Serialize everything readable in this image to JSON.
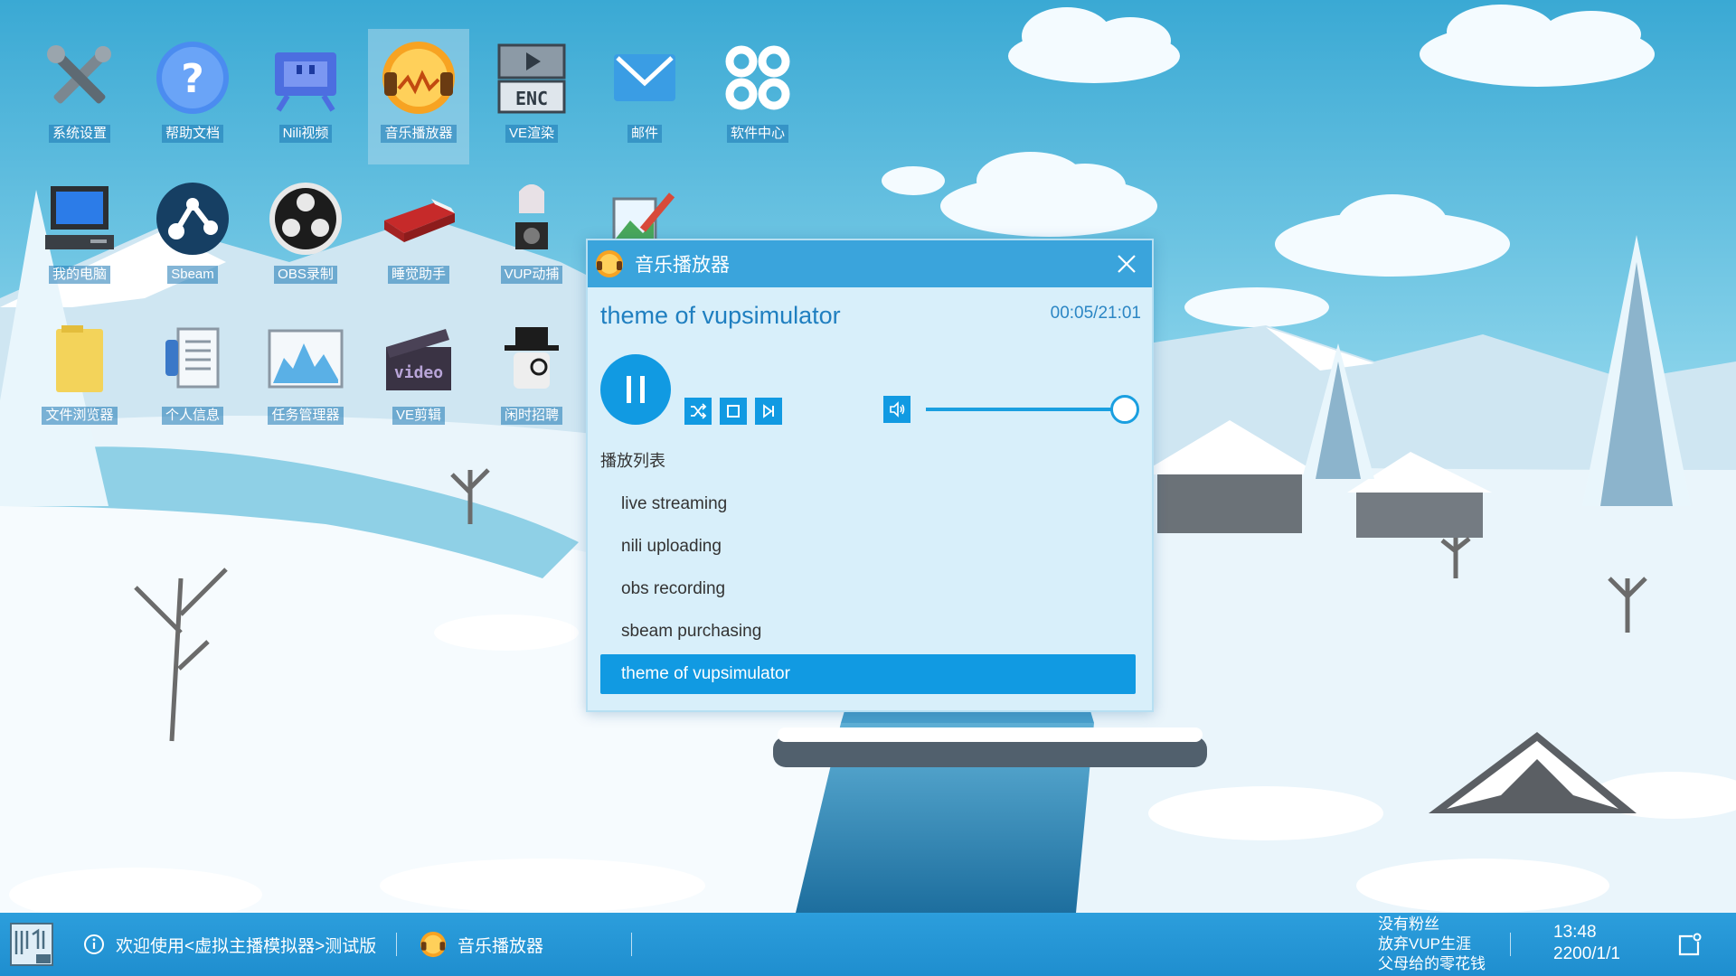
{
  "desktop": {
    "icons": [
      {
        "label": "系统设置",
        "icon": "tools-icon"
      },
      {
        "label": "帮助文档",
        "icon": "help-icon"
      },
      {
        "label": "Nili视频",
        "icon": "tv-icon"
      },
      {
        "label": "音乐播放器",
        "icon": "music-player-icon",
        "selected": true
      },
      {
        "label": "VE渲染",
        "icon": "encoder-icon"
      },
      {
        "label": "邮件",
        "icon": "mail-icon"
      },
      {
        "label": "软件中心",
        "icon": "app-center-icon"
      },
      {
        "label": "我的电脑",
        "icon": "computer-icon"
      },
      {
        "label": "Sbeam",
        "icon": "sbeam-icon"
      },
      {
        "label": "OBS录制",
        "icon": "obs-icon"
      },
      {
        "label": "睡觉助手",
        "icon": "bed-icon"
      },
      {
        "label": "VUP动捕",
        "icon": "motion-capture-icon"
      },
      {
        "label": "",
        "icon": "paint-icon"
      },
      {
        "label": "文件浏览器",
        "icon": "folder-icon"
      },
      {
        "label": "个人信息",
        "icon": "profile-icon"
      },
      {
        "label": "任务管理器",
        "icon": "task-manager-icon"
      },
      {
        "label": "VE剪辑",
        "icon": "video-editor-icon"
      },
      {
        "label": "闲时招聘",
        "icon": "recruit-icon"
      }
    ]
  },
  "player": {
    "window_title": "音乐播放器",
    "song_title": "theme of vupsimulator",
    "time": "00:05/21:01",
    "volume": 1.0,
    "playlist_label": "播放列表",
    "playlist": [
      {
        "name": "live streaming"
      },
      {
        "name": "nili uploading"
      },
      {
        "name": "obs recording"
      },
      {
        "name": "sbeam purchasing"
      },
      {
        "name": "theme of vupsimulator",
        "active": true
      }
    ]
  },
  "taskbar": {
    "notice": "欢迎使用<虚拟主播模拟器>测试版",
    "app_label": "音乐播放器",
    "status": [
      "没有粉丝",
      "放弃VUP生涯",
      "父母给的零花钱"
    ],
    "time": "13:48",
    "date": "2200/1/1"
  },
  "colors": {
    "accent": "#119ae2",
    "titlebar": "#3aa4dc",
    "taskbar": "#1f8ecf"
  }
}
